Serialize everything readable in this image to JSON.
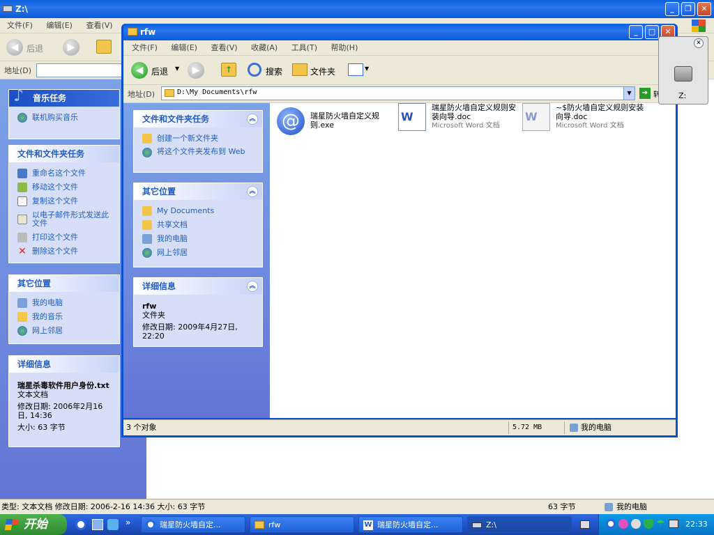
{
  "back_window": {
    "title": "Z:\\",
    "menu": [
      "文件(F)",
      "编辑(E)",
      "查看(V)"
    ],
    "toolbar": {
      "back": "后退"
    },
    "address_label": "地址(D)",
    "music_tasks": {
      "title": "音乐任务",
      "items": [
        "联机购买音乐"
      ]
    },
    "file_tasks": {
      "title": "文件和文件夹任务",
      "items": [
        "重命名这个文件",
        "移动这个文件",
        "复制这个文件",
        "以电子邮件形式发送此文件",
        "打印这个文件",
        "删除这个文件"
      ]
    },
    "other_places": {
      "title": "其它位置",
      "items": [
        "我的电脑",
        "我的音乐",
        "网上邻居"
      ]
    },
    "details": {
      "title": "详细信息",
      "name": "瑞星杀毒软件用户身份.txt",
      "type": "文本文档",
      "modified": "修改日期: 2006年2月16日, 14:36",
      "size": "大小: 63 字节"
    },
    "status": {
      "main": "类型: 文本文档 修改日期: 2006-2-16 14:36 大小: 63 字节",
      "size": "63 字节",
      "zone": "我的电脑"
    }
  },
  "front_window": {
    "title": "rfw",
    "menu": [
      "文件(F)",
      "编辑(E)",
      "查看(V)",
      "收藏(A)",
      "工具(T)",
      "帮助(H)"
    ],
    "toolbar": {
      "back": "后退",
      "search": "搜索",
      "folders": "文件夹"
    },
    "address_label": "地址(D)",
    "address_value": "D:\\My Documents\\rfw",
    "go": "转到",
    "file_tasks": {
      "title": "文件和文件夹任务",
      "items": [
        "创建一个新文件夹",
        "将这个文件夹发布到 Web"
      ]
    },
    "other_places": {
      "title": "其它位置",
      "items": [
        "My Documents",
        "共享文档",
        "我的电脑",
        "网上邻居"
      ]
    },
    "details": {
      "title": "详细信息",
      "name": "rfw",
      "type": "文件夹",
      "modified": "修改日期: 2009年4月27日, 22:20"
    },
    "files": [
      {
        "name": "瑞星防火墙自定义规则.exe",
        "sub": ""
      },
      {
        "name": "瑞星防火墙自定义规则安装向导.doc",
        "sub": "Microsoft Word 文档"
      },
      {
        "name": "~$防火墙自定义规则安装向导.doc",
        "sub": "Microsoft Word 文档"
      }
    ],
    "status": {
      "count": "3 个对象",
      "size": "5.72 MB",
      "zone": "我的电脑"
    }
  },
  "drive_popup": {
    "label": "Z:"
  },
  "taskbar": {
    "start": "开始",
    "tasks": [
      "瑞星防火墙自定...",
      "rfw",
      "瑞星防火墙自定...",
      "Z:\\"
    ],
    "clock": "22:33"
  },
  "colors": {
    "xp_blue": "#0a5fe0",
    "link_blue": "#215dc6",
    "start_green": "#3c9a3c"
  }
}
